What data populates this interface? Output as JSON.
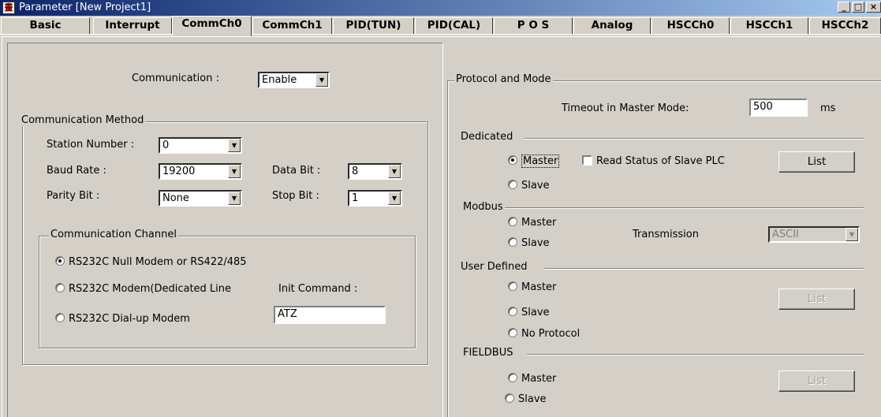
{
  "window": {
    "title": "Parameter [New Project1]",
    "minimize": "_",
    "maximize": "□",
    "close": "×"
  },
  "tabs": [
    "Basic",
    "Interrupt",
    "CommCh0",
    "CommCh1",
    "PID(TUN)",
    "PID(CAL)",
    "P O S",
    "Analog",
    "HSCCh0",
    "HSCCh1",
    "HSCCh2"
  ],
  "active_tab": "CommCh0",
  "communication": {
    "label": "Communication :",
    "value": "Enable"
  },
  "method": {
    "title": "Communication Method",
    "station_label": "Station Number :",
    "station_value": "0",
    "baud_label": "Baud Rate :",
    "baud_value": "19200",
    "databit_label": "Data Bit :",
    "databit_value": "8",
    "parity_label": "Parity Bit :",
    "parity_value": "None",
    "stopbit_label": "Stop Bit :",
    "stopbit_value": "1"
  },
  "channel": {
    "title": "Communication Channel",
    "opt1": "RS232C Null Modem or RS422/485",
    "opt2": "RS232C Modem(Dedicated Line",
    "init_label": "Init Command :",
    "opt3": "RS232C Dial-up Modem",
    "init_value": "ATZ",
    "selected": "opt1"
  },
  "protocol": {
    "title": "Protocol and Mode",
    "timeout_label": "Timeout in Master Mode:",
    "timeout_value": "500",
    "timeout_unit": "ms",
    "dedicated": {
      "title": "Dedicated",
      "master": "Master",
      "slave": "Slave",
      "read_status": "Read Status of Slave PLC",
      "list": "List",
      "selected": "master"
    },
    "modbus": {
      "title": "Modbus",
      "master": "Master",
      "slave": "Slave",
      "transmission_label": "Transmission",
      "transmission_value": "ASCII"
    },
    "user": {
      "title": "User Defined",
      "master": "Master",
      "slave": "Slave",
      "noproto": "No Protocol",
      "list": "List"
    },
    "fieldbus": {
      "title": "FIELDBUS",
      "master": "Master",
      "slave": "Slave",
      "list": "List"
    }
  }
}
